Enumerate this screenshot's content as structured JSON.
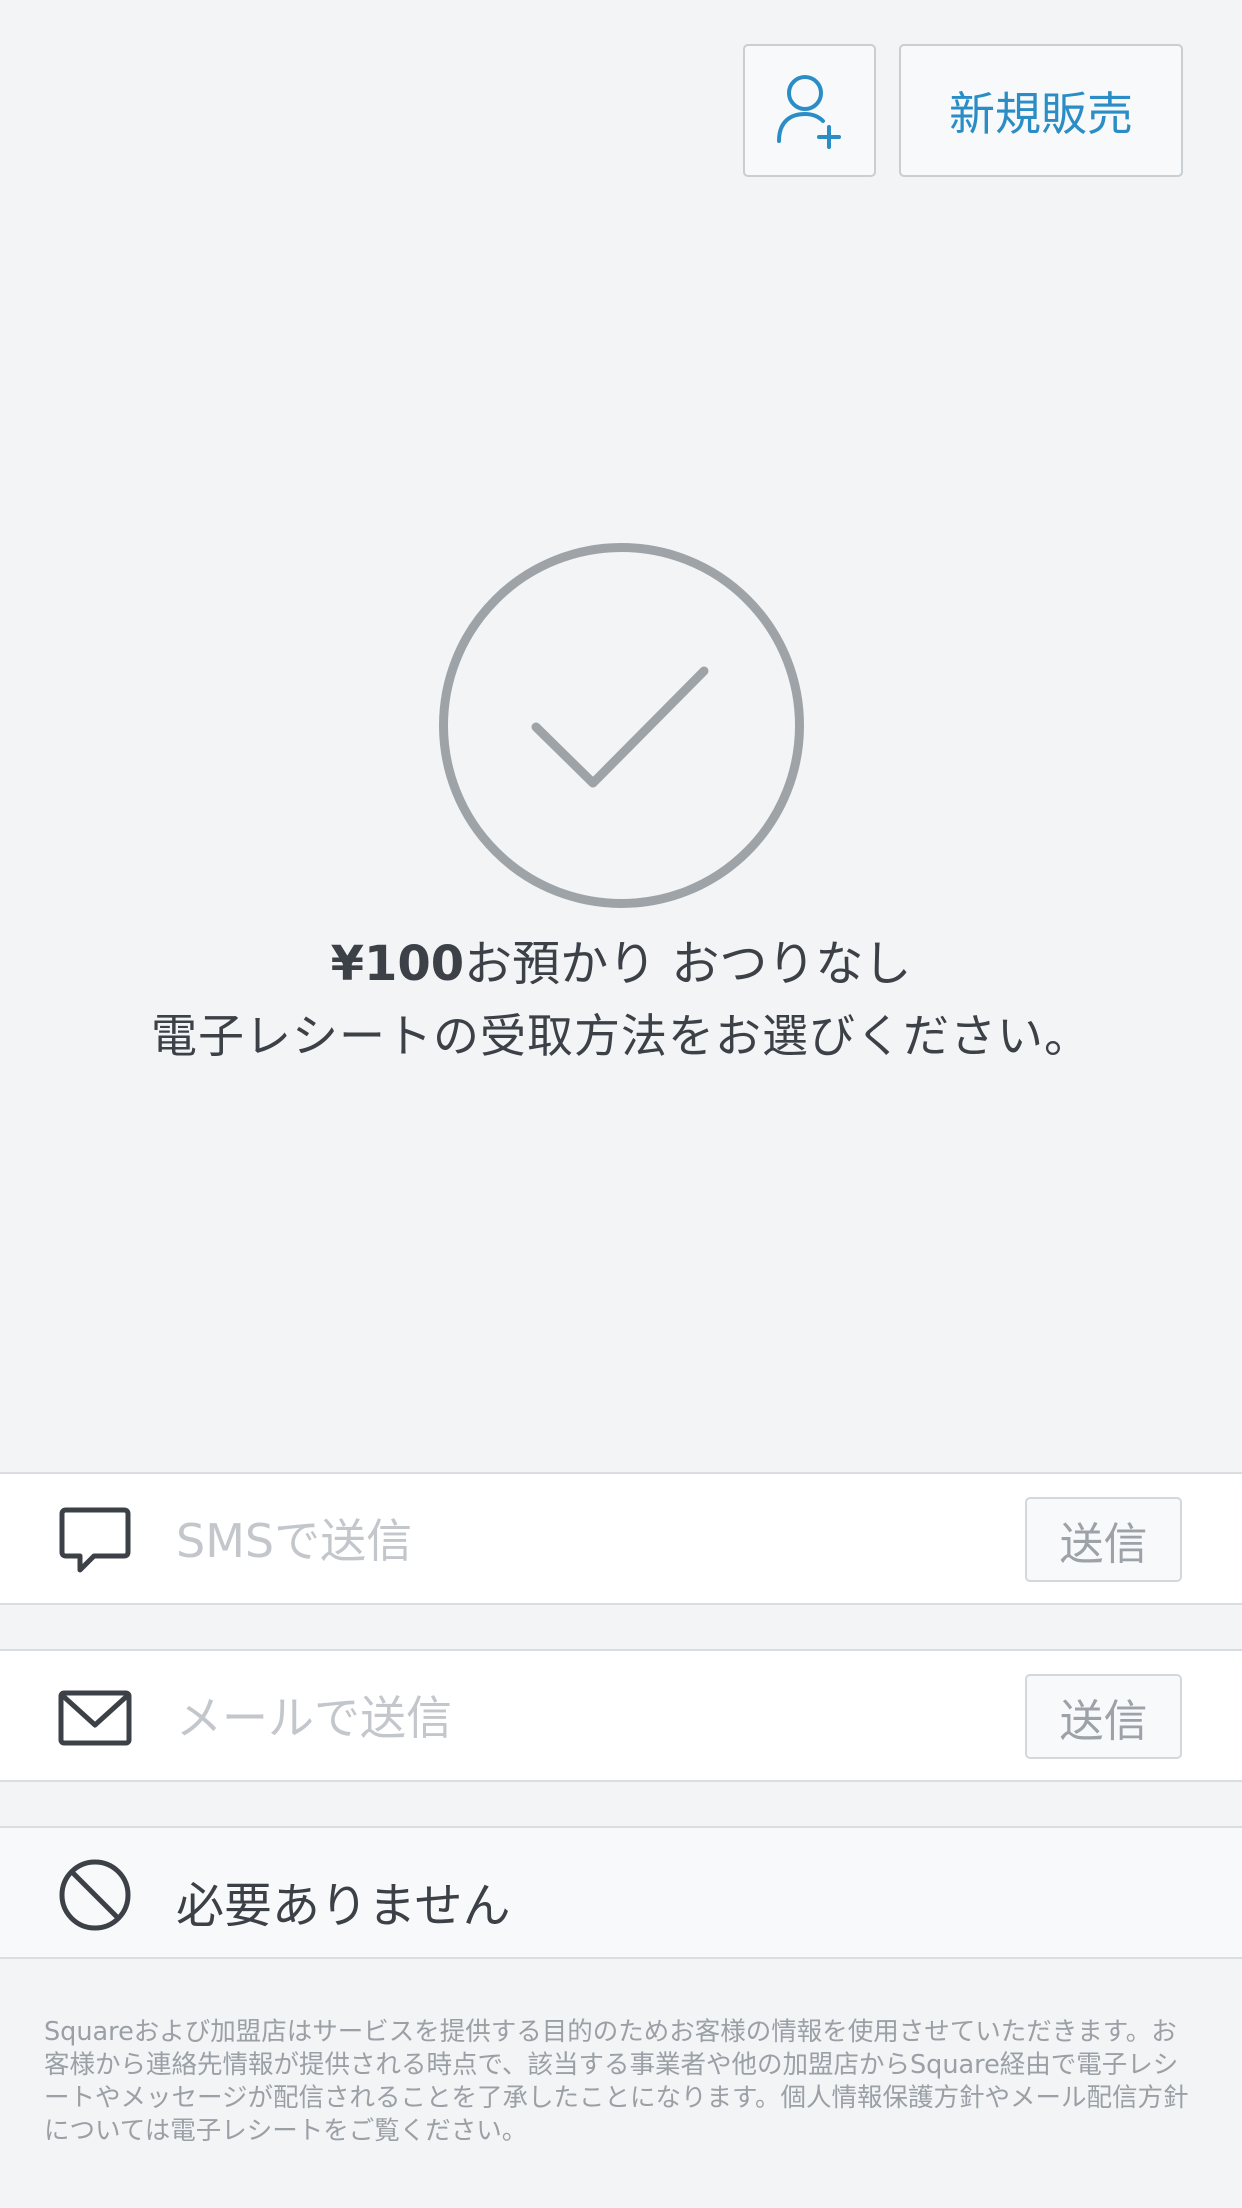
{
  "header": {
    "customer_icon": "add-customer-icon",
    "new_sale_label": "新規販売"
  },
  "status": {
    "icon": "check-circle-icon",
    "amount": "¥100",
    "tendered_text": "お預かり おつりなし",
    "prompt": "電子レシートの受取方法をお選びください。"
  },
  "sms": {
    "icon": "chat-bubble-icon",
    "placeholder": "SMSで送信",
    "value": "",
    "send_label": "送信"
  },
  "email": {
    "icon": "envelope-icon",
    "placeholder": "メールで送信",
    "value": "",
    "send_label": "送信"
  },
  "no_receipt": {
    "icon": "prohibited-icon",
    "label": "必要ありません"
  },
  "footer": {
    "disclaimer": "Squareおよび加盟店はサービスを提供する目的のためお客様の情報を使用させていただきます。お客様から連絡先情報が提供される時点で、該当する事業者や他の加盟店からSquare経由で電子レシートやメッセージが配信されることを了承したことになります。個人情報保護方針やメール配信方針については電子レシートをご覧ください。"
  },
  "colors": {
    "background": "#f2f4f6",
    "accent": "#2b8dc6",
    "check_gray": "#9ea3a8",
    "text": "#3c4047",
    "muted": "#9aa0a6"
  }
}
